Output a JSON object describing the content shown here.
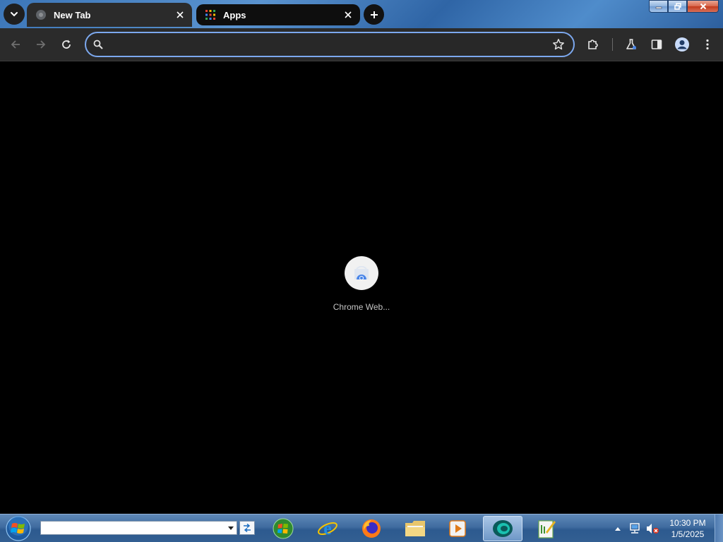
{
  "browser": {
    "tabs": [
      {
        "label": "New Tab",
        "active": true
      },
      {
        "label": "Apps",
        "active": false
      }
    ],
    "omnibox": {
      "value": "",
      "placeholder": ""
    },
    "colors": {
      "accent": "#7ca8ee",
      "toolbar": "#2b2b2b",
      "content": "#000000"
    }
  },
  "content": {
    "shortcuts": [
      {
        "label": "Chrome Web...",
        "icon": "chrome-web-store-icon"
      }
    ]
  },
  "taskbar": {
    "address": {
      "value": ""
    },
    "apps": [
      {
        "name": "windows-media-center-icon"
      },
      {
        "name": "internet-explorer-icon"
      },
      {
        "name": "firefox-icon"
      },
      {
        "name": "file-explorer-icon"
      },
      {
        "name": "media-player-icon"
      },
      {
        "name": "chrome-icon",
        "active": true
      },
      {
        "name": "notepad-plus-plus-icon"
      }
    ],
    "clock": {
      "time": "10:30 PM",
      "date": "1/5/2025"
    }
  }
}
